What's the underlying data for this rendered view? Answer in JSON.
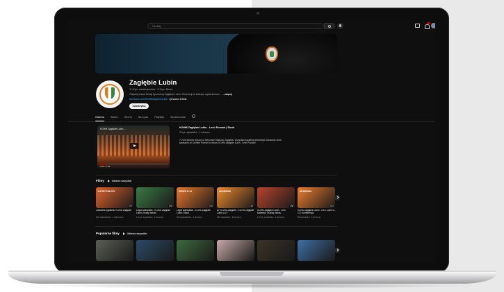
{
  "header": {
    "search_placeholder": "Szukaj"
  },
  "channel": {
    "name": "Zagłębie Lubin",
    "meta": "11,8 tys. subskrybentów · 2,3 tys. filmów",
    "description": "Oficjalny kanał Sekcji Sportowej Zagłębie Lubin. Obserwuj na bieżąco wydarzenia z...",
    "more_label": "...więcej",
    "link": "facebook.com/KGHMZaglebieLubin",
    "link_extra": "i jeszcze 4 linki",
    "subscribe_label": "Subskrybuj"
  },
  "tabs": [
    {
      "label": "Główna",
      "active": true
    },
    {
      "label": "Wideo"
    },
    {
      "label": "Shorts"
    },
    {
      "label": "Na żywo"
    },
    {
      "label": "Playlisty"
    },
    {
      "label": "Społeczność"
    }
  ],
  "featured": {
    "thumb_title": "KGHM Zagłębie Lubin ...",
    "time": "0:00 / 2:04",
    "title": "KGHM Zagłębie Lubin - Lech Poznań | Skrót",
    "meta": "32 tys. wyświetleń · 1 rok temu",
    "description": "71 000 kibiców wyszło na trybunach Stadionu Zagłębia i chwycięło kapitalną atmosferę! Zobaczcie skrót spotkania ze Lechem Poznań w meczu KGHM Zagłębie Lubin - Lech Poznań!"
  },
  "shelf_films": {
    "title": "Filmy",
    "play_all": "Odtwórz wszystkie",
    "videos": [
      {
        "label": "ŁATWY ZAŁOŻY",
        "duration": "2:07",
        "title": "Zawodnik tygodnia: KGHM Zagłębie",
        "meta": "162 wyświetlenia · 1 dzień temu",
        "color": "#e0632a"
      },
      {
        "label": "",
        "duration": "0:53",
        "title": "Legia Warszawa - KGHM Zagłębie Lubin | Kulisy meczu",
        "meta": "1,2 tys. wyświetleń · 2 dni temu",
        "color": "#3a7a44"
      },
      {
        "label": "GRUPA U-14",
        "duration": "4:16",
        "title": "Legia Warszawa - KGHM Zagłębie Lubin | Skrót",
        "meta": "324 wyświetlenia · 3 dni temu",
        "color": "#e8782b"
      },
      {
        "label": "AKADEMIA",
        "duration": "1:02",
        "title": "AP KGHM Zagłębie - KGHM Zagłębie Lubin U-17",
        "meta": "201 wyświetleń · 3 dni temu",
        "color": "#f08a2c"
      },
      {
        "label": "",
        "duration": "1:58",
        "title": "KGHM Zagłębie Lubin - GKS Katowice | Kulisy meczu",
        "meta": "1,3 tys. wyświetleń · 4 dni temu",
        "color": "#b8452a"
      },
      {
        "label": "AKADEMIA",
        "duration": "3:12",
        "title": "KGHM Zagłębie Lubin - GKS Lubin U-17 | Konferencja",
        "meta": "98 wyświetleń · 5 dni temu",
        "color": "#ef7e2c"
      }
    ]
  },
  "shelf_popular": {
    "title": "Popularne filmy",
    "play_all": "Odtwórz wszystkie",
    "videos": [
      {
        "duration": "",
        "color": "#5a5f55"
      },
      {
        "duration": "",
        "color": "#2c4a66"
      },
      {
        "duration": "",
        "color": "#3d6a3e"
      },
      {
        "duration": "",
        "color": "#c8a9a8"
      },
      {
        "duration": "",
        "color": "#3a3326"
      },
      {
        "duration": "",
        "color": "#3f6fa5"
      }
    ]
  }
}
